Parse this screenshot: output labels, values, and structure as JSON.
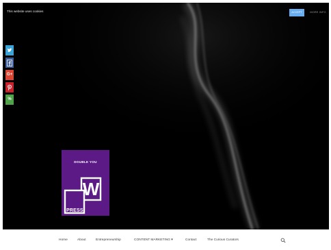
{
  "cookie_bar": {
    "message": "This website uses cookies",
    "accept_label": "ACCEPT",
    "more_info_label": "MORE INFO",
    "accept_color": "#68aef0"
  },
  "share_bar": {
    "items": [
      {
        "icon": "twitter-icon",
        "color": "#3aa4d9"
      },
      {
        "icon": "facebook-icon",
        "color": "#3b5b9a"
      },
      {
        "icon": "google-plus-icon",
        "color": "#d94635"
      },
      {
        "icon": "pinterest-icon",
        "color": "#c8232c"
      },
      {
        "icon": "share-icon",
        "color": "#4fa24a",
        "glyph": "%"
      }
    ]
  },
  "logo": {
    "title": "DOUBLE YOU",
    "letter": "W",
    "word": "PRESS",
    "background": "#5c1a86"
  },
  "nav": {
    "items": [
      {
        "label": "Home"
      },
      {
        "label": "About"
      },
      {
        "label": "Entrepreneurship"
      },
      {
        "label": "CONTENT MARKETING ▾"
      },
      {
        "label": "Contact"
      },
      {
        "label": "The Curious Curators"
      }
    ],
    "search_icon": "search-icon"
  }
}
